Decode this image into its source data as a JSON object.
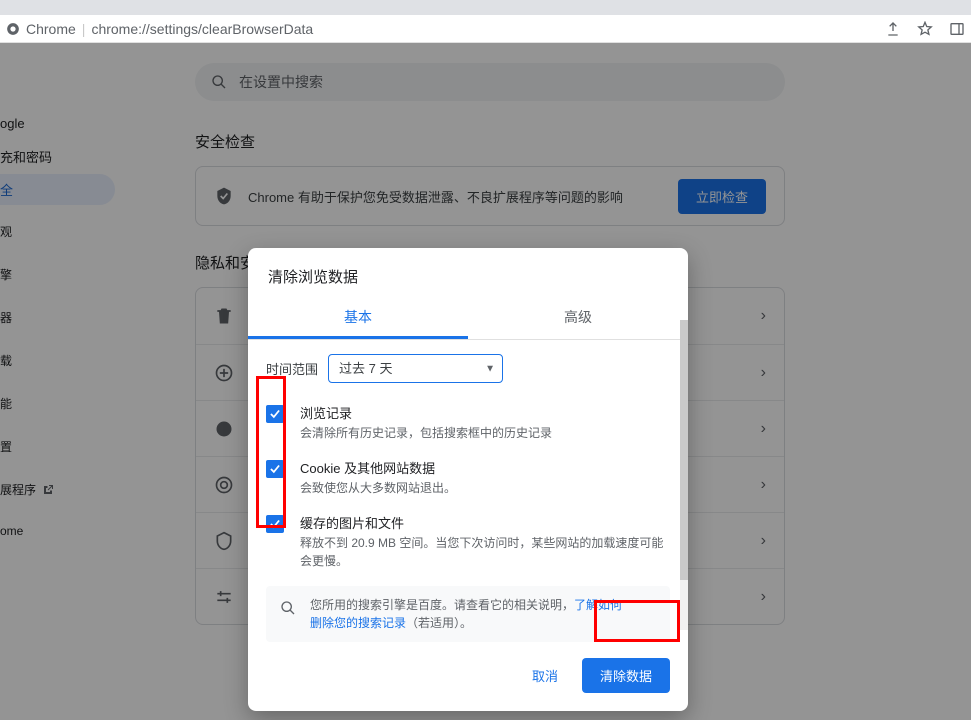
{
  "browser": {
    "secure_label": "Chrome",
    "url": "chrome://settings/clearBrowserData"
  },
  "sidebar": {
    "items": [
      {
        "label": "ogle"
      },
      {
        "label": "充和密码"
      },
      {
        "label": "全"
      },
      {
        "label": "观"
      },
      {
        "label": "擎"
      },
      {
        "label": "器"
      },
      {
        "label": "载"
      },
      {
        "label": "能"
      },
      {
        "label": "置"
      }
    ],
    "ext_label": "展程序",
    "about_label": "ome"
  },
  "search": {
    "placeholder": "在设置中搜索"
  },
  "safety": {
    "heading": "安全检查",
    "text": "Chrome 有助于保护您免受数据泄露、不良扩展程序等问题的影响",
    "button": "立即检查"
  },
  "privacy": {
    "heading": "隐私和安全",
    "row_icons": [
      "trash",
      "plus",
      "cookie",
      "target",
      "shield",
      "sliders"
    ]
  },
  "dialog": {
    "title": "清除浏览数据",
    "tabs": {
      "basic": "基本",
      "advanced": "高级"
    },
    "time_label": "时间范围",
    "time_value": "过去 7 天",
    "options": [
      {
        "title": "浏览记录",
        "desc": "会清除所有历史记录，包括搜索框中的历史记录"
      },
      {
        "title": "Cookie 及其他网站数据",
        "desc": "会致使您从大多数网站退出。"
      },
      {
        "title": "缓存的图片和文件",
        "desc": "释放不到 20.9 MB 空间。当您下次访问时，某些网站的加载速度可能会更慢。"
      }
    ],
    "info_prefix": "您所用的搜索引擎是百度。请查看它的相关说明，",
    "info_link": "了解如何删除您的搜索记录",
    "info_suffix": "（若适用）。",
    "cancel": "取消",
    "confirm": "清除数据"
  }
}
